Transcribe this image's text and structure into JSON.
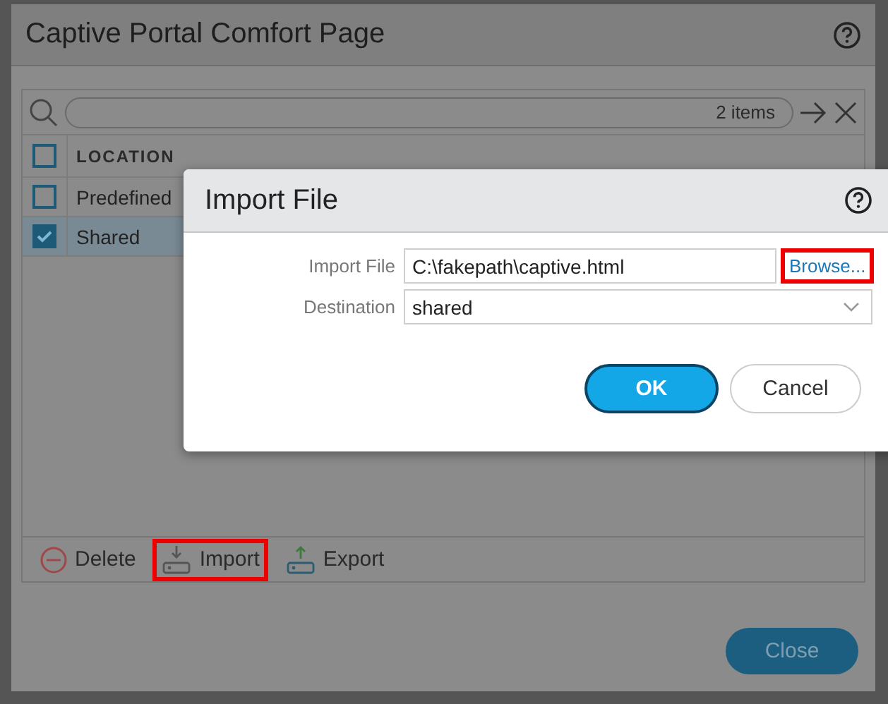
{
  "window": {
    "title": "Captive Portal Comfort Page"
  },
  "search": {
    "count": "2 items"
  },
  "table": {
    "columns": [
      "LOCATION"
    ],
    "header_checked": false,
    "rows": [
      {
        "location": "Predefined",
        "checked": false
      },
      {
        "location": "Shared",
        "checked": true
      }
    ]
  },
  "toolbar": [
    {
      "kind": "delete",
      "label": "Delete",
      "highlighted": false
    },
    {
      "kind": "import",
      "label": "Import",
      "highlighted": true
    },
    {
      "kind": "export",
      "label": "Export",
      "highlighted": false
    }
  ],
  "close_button": "Close",
  "dialog": {
    "title": "Import File",
    "fields": [
      {
        "kind": "file",
        "label": "Import File",
        "value": "C:\\fakepath\\captive.html",
        "button": "Browse...",
        "button_highlighted": true
      },
      {
        "kind": "select",
        "label": "Destination",
        "value": "shared"
      }
    ],
    "buttons": [
      {
        "label": "OK",
        "primary": true
      },
      {
        "label": "Cancel",
        "primary": false
      }
    ]
  }
}
